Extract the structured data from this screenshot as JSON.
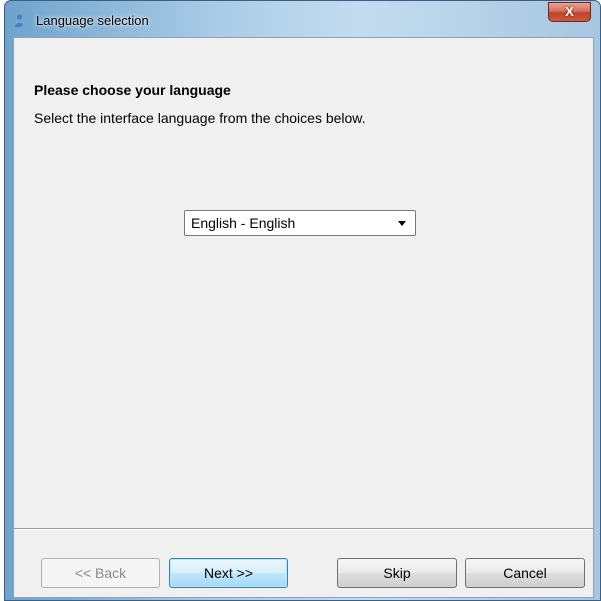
{
  "window": {
    "title": "Language selection",
    "close_label": "X",
    "icon": "people-icon"
  },
  "content": {
    "heading": "Please choose your language",
    "description": "Select the interface language from the choices below."
  },
  "language_select": {
    "selected": "English - English",
    "arrow_icon": "dropdown-arrow-icon"
  },
  "buttons": {
    "back": "<< Back",
    "next": "Next >>",
    "skip": "Skip",
    "cancel": "Cancel"
  },
  "colors": {
    "default_button_border": "#3c7fb1",
    "close_button": "#c0432b"
  }
}
